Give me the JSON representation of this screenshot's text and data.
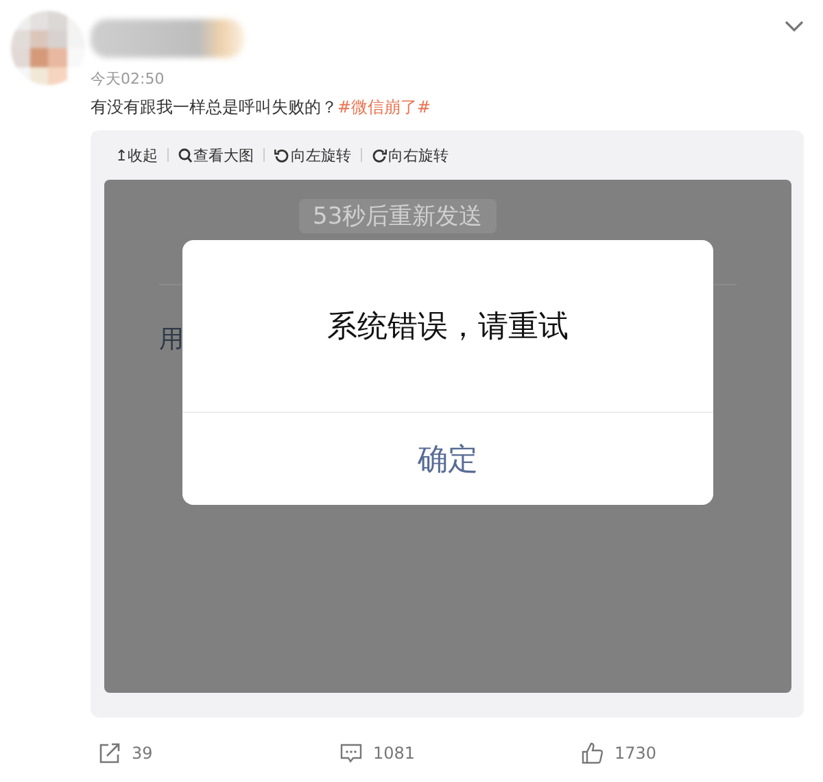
{
  "post": {
    "time": "今天02:50",
    "text": "有没有跟我一样总是呼叫失败的？",
    "topic": "#微信崩了#"
  },
  "toolbar": [
    "↥收起",
    "查看大图",
    "向左旋转",
    "向右旋转"
  ],
  "screenshot": {
    "background_button": "53秒后重新发送",
    "background_text": "用",
    "dialog": {
      "message": "系统错误，请重试",
      "button": "确定"
    }
  },
  "actions": [
    {
      "kind": "share",
      "count": "39"
    },
    {
      "kind": "comment",
      "count": "1081"
    },
    {
      "kind": "like",
      "count": "1730"
    }
  ]
}
